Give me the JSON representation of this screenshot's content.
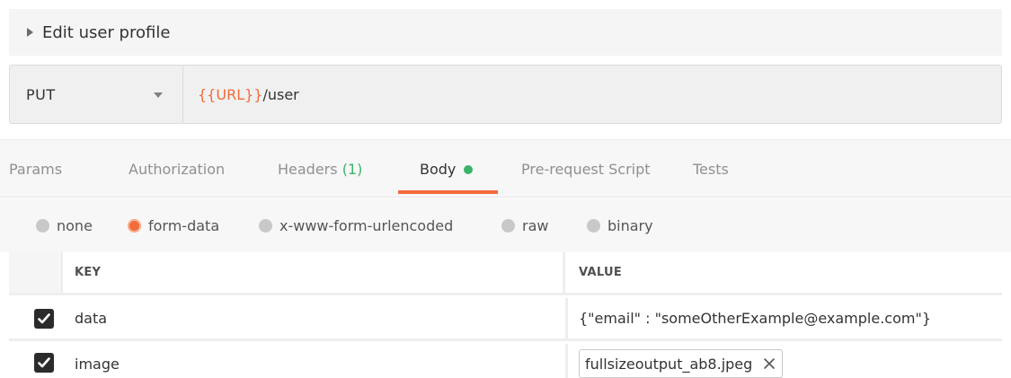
{
  "request": {
    "title": "Edit user profile",
    "method": "PUT",
    "url_variable": "{{URL}}",
    "url_path": "/user"
  },
  "tabs": [
    {
      "label": "Params",
      "active": false
    },
    {
      "label": "Authorization",
      "active": false
    },
    {
      "label": "Headers",
      "count": "(1)",
      "active": false
    },
    {
      "label": "Body",
      "active": true
    },
    {
      "label": "Pre-request Script",
      "active": false
    },
    {
      "label": "Tests",
      "active": false
    }
  ],
  "body_types": [
    {
      "label": "none",
      "selected": false
    },
    {
      "label": "form-data",
      "selected": true
    },
    {
      "label": "x-www-form-urlencoded",
      "selected": false
    },
    {
      "label": "raw",
      "selected": false
    },
    {
      "label": "binary",
      "selected": false
    }
  ],
  "table": {
    "headers": {
      "key": "KEY",
      "value": "VALUE"
    },
    "rows": [
      {
        "checked": true,
        "key": "data",
        "value": "{\"email\" : \"someOtherExample@example.com\"}"
      },
      {
        "checked": true,
        "key": "image",
        "file": "fullsizeoutput_ab8.jpeg"
      }
    ]
  },
  "colors": {
    "accent": "#f26b3a",
    "indicator": "#3bb36b"
  },
  "icons": [
    "collapse-caret-icon",
    "dropdown-arrow-icon",
    "checkmark-icon",
    "remove-file-icon"
  ]
}
